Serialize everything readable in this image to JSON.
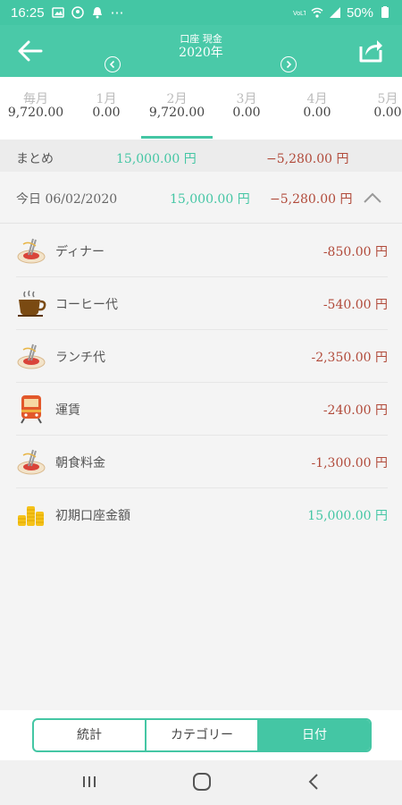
{
  "status": {
    "time": "16:25",
    "dots": "⋯",
    "battery": "50%"
  },
  "header": {
    "subtitle": "口座 現金",
    "year": "2020年"
  },
  "tabs": [
    {
      "label": "毎月",
      "value": "9,720.00"
    },
    {
      "label": "1月",
      "value": "0.00"
    },
    {
      "label": "2月",
      "value": "9,720.00"
    },
    {
      "label": "3月",
      "value": "0.00"
    },
    {
      "label": "4月",
      "value": "0.00"
    },
    {
      "label": "5月",
      "value": "0.00"
    }
  ],
  "summary": {
    "label": "まとめ",
    "income": "15,000.00 円",
    "expense": "−5,280.00 円"
  },
  "day": {
    "label": "今日 06/02/2020",
    "income": "15,000.00 円",
    "expense": "−5,280.00 円"
  },
  "items": [
    {
      "name": "ディナー",
      "amount": "-850.00 円",
      "icon": "pasta-icon"
    },
    {
      "name": "コーヒー代",
      "amount": "-540.00 円",
      "icon": "coffee-icon"
    },
    {
      "name": "ランチ代",
      "amount": "-2,350.00 円",
      "icon": "pasta-icon"
    },
    {
      "name": "運賃",
      "amount": "-240.00 円",
      "icon": "train-icon"
    },
    {
      "name": "朝食料金",
      "amount": "-1,300.00 円",
      "icon": "pasta-icon"
    },
    {
      "name": "初期口座金額",
      "amount": "15,000.00 円",
      "icon": "coins-icon"
    }
  ],
  "segments": [
    "統計",
    "カテゴリー",
    "日付"
  ],
  "colors": {
    "accent": "#44c6a4",
    "expense": "#b14a3a"
  }
}
